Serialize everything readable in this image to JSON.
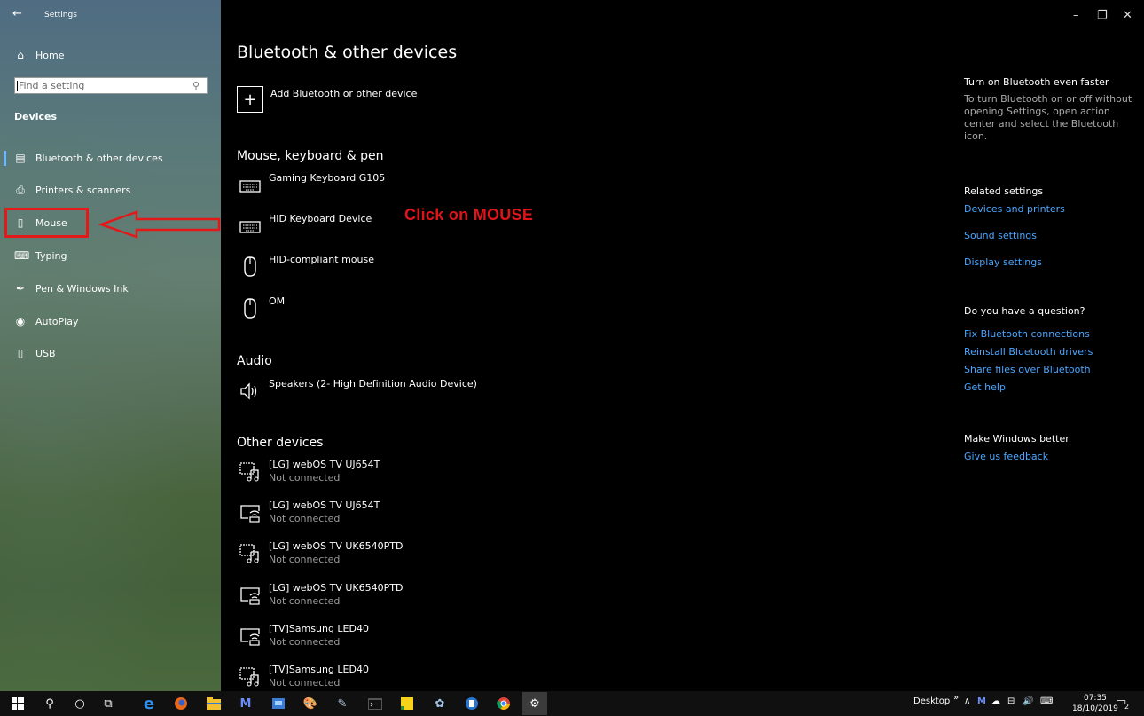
{
  "window": {
    "title": "Settings",
    "back_icon": "back-arrow-icon",
    "controls": {
      "minimize": "–",
      "restore": "❐",
      "close": "✕"
    }
  },
  "sidebar": {
    "home_label": "Home",
    "search": {
      "placeholder": "Find a setting"
    },
    "section_heading": "Devices",
    "items": [
      {
        "label": "Bluetooth & other devices",
        "icon": "bluetooth-devices-icon",
        "selected": true
      },
      {
        "label": "Printers & scanners",
        "icon": "printer-icon"
      },
      {
        "label": "Mouse",
        "icon": "mouse-icon"
      },
      {
        "label": "Typing",
        "icon": "keyboard-icon"
      },
      {
        "label": "Pen & Windows Ink",
        "icon": "pen-icon"
      },
      {
        "label": "AutoPlay",
        "icon": "autoplay-icon"
      },
      {
        "label": "USB",
        "icon": "usb-icon"
      }
    ],
    "accent_color": "#6cb6ff"
  },
  "main": {
    "title": "Bluetooth & other devices",
    "add_device_label": "Add Bluetooth or other device",
    "annotation": "Click on MOUSE",
    "annotation_color": "#e0141a",
    "groups": {
      "input": {
        "heading": "Mouse, keyboard & pen",
        "devices": [
          {
            "name": "Gaming Keyboard G105",
            "icon": "keyboard-icon"
          },
          {
            "name": "HID Keyboard Device",
            "icon": "keyboard-icon"
          },
          {
            "name": "HID-compliant mouse",
            "icon": "mouse-icon"
          },
          {
            "name": "OM",
            "icon": "mouse-icon"
          }
        ]
      },
      "audio": {
        "heading": "Audio",
        "devices": [
          {
            "name": "Speakers (2- High Definition Audio Device)",
            "icon": "speaker-icon"
          }
        ]
      },
      "other": {
        "heading": "Other devices",
        "devices": [
          {
            "name": "[LG] webOS TV UJ654T",
            "status": "Not connected",
            "icon": "media-device-icon"
          },
          {
            "name": "[LG] webOS TV UJ654T",
            "status": "Not connected",
            "icon": "network-display-icon"
          },
          {
            "name": "[LG] webOS TV UK6540PTD",
            "status": "Not connected",
            "icon": "media-device-icon"
          },
          {
            "name": "[LG] webOS TV UK6540PTD",
            "status": "Not connected",
            "icon": "network-display-icon"
          },
          {
            "name": "[TV]Samsung LED40",
            "status": "Not connected",
            "icon": "network-display-icon"
          },
          {
            "name": "[TV]Samsung LED40",
            "status": "Not connected",
            "icon": "media-device-icon"
          }
        ]
      }
    }
  },
  "right_panel": {
    "faster_heading": "Turn on Bluetooth even faster",
    "faster_text": "To turn Bluetooth on or off without opening Settings, open action center and select the Bluetooth icon.",
    "related_heading": "Related settings",
    "related_links": [
      "Devices and printers",
      "Sound settings",
      "Display settings"
    ],
    "question_heading": "Do you have a question?",
    "question_links": [
      "Fix Bluetooth connections",
      "Reinstall Bluetooth drivers",
      "Share files over Bluetooth",
      "Get help"
    ],
    "better_heading": "Make Windows better",
    "feedback_link": "Give us feedback",
    "link_color": "#4aa6ff"
  },
  "taskbar": {
    "desktop_label": "Desktop",
    "overflow": "»",
    "time": "07:35",
    "date": "18/10/2019",
    "notification_count": "2"
  }
}
